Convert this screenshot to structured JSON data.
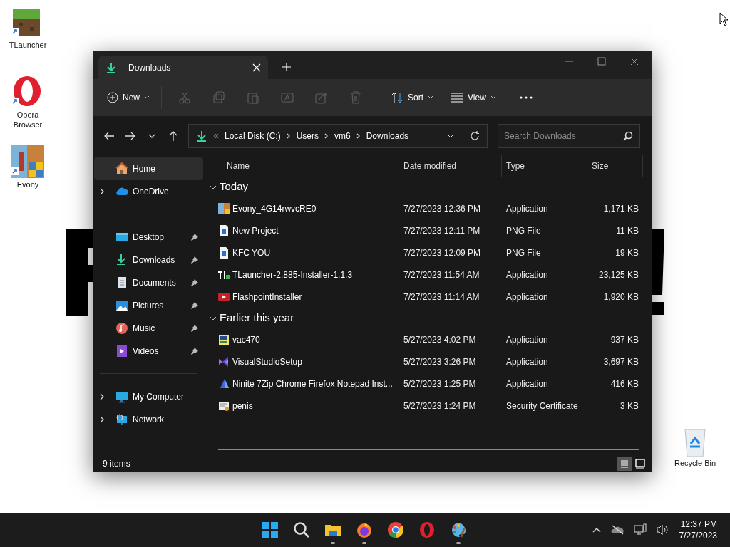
{
  "desktop_icons": [
    {
      "kind": "grass",
      "label": "TLauncher"
    },
    {
      "kind": "opera",
      "label": "Opera Browser"
    },
    {
      "kind": "evony",
      "label": "Evony"
    }
  ],
  "recycle_bin": {
    "label": "Recycle Bin"
  },
  "window": {
    "tab": {
      "title": "Downloads",
      "selected": true
    },
    "toolbar": {
      "new_label": "New",
      "tools": [
        {
          "kind": "cut",
          "disabled": true
        },
        {
          "kind": "copy",
          "disabled": true
        },
        {
          "kind": "paste",
          "disabled": true
        },
        {
          "kind": "rename",
          "disabled": true
        },
        {
          "kind": "share",
          "disabled": true
        },
        {
          "kind": "delete",
          "disabled": true
        }
      ],
      "sort_label": "Sort",
      "view_label": "View"
    },
    "address": {
      "segments": [
        "Local Disk (C:)",
        "Users",
        "vm6",
        "Downloads"
      ],
      "search_placeholder": "Search Downloads"
    },
    "sidebar": {
      "groups": [
        [
          {
            "kind": "home",
            "label": "Home",
            "selected": true,
            "expandable": false,
            "pinned": false
          },
          {
            "kind": "cloud",
            "label": "OneDrive",
            "selected": false,
            "expandable": true,
            "pinned": false
          }
        ],
        [
          {
            "kind": "desktop",
            "label": "Desktop",
            "selected": false,
            "expandable": false,
            "pinned": true
          },
          {
            "kind": "download",
            "label": "Downloads",
            "selected": false,
            "expandable": false,
            "pinned": true
          },
          {
            "kind": "document",
            "label": "Documents",
            "selected": false,
            "expandable": false,
            "pinned": true
          },
          {
            "kind": "pictures",
            "label": "Pictures",
            "selected": false,
            "expandable": false,
            "pinned": true
          },
          {
            "kind": "music",
            "label": "Music",
            "selected": false,
            "expandable": false,
            "pinned": true
          },
          {
            "kind": "videos",
            "label": "Videos",
            "selected": false,
            "expandable": false,
            "pinned": true
          }
        ],
        [
          {
            "kind": "computer",
            "label": "My Computer",
            "selected": false,
            "expandable": true,
            "pinned": false
          },
          {
            "kind": "network",
            "label": "Network",
            "selected": false,
            "expandable": true,
            "pinned": false
          }
        ]
      ]
    },
    "columns": [
      "Name",
      "Date modified",
      "Type",
      "Size"
    ],
    "groups": [
      {
        "title": "Today",
        "expanded": true,
        "files": [
          {
            "kind": "evony",
            "name": "Evony_4G14rwvcRE0",
            "date": "7/27/2023 12:36 PM",
            "type": "Application",
            "size": "1,171 KB"
          },
          {
            "kind": "png",
            "name": "New Project",
            "date": "7/27/2023 12:11 PM",
            "type": "PNG File",
            "size": "11 KB"
          },
          {
            "kind": "png",
            "name": "KFC YOU",
            "date": "7/27/2023 12:09 PM",
            "type": "PNG File",
            "size": "19 KB"
          },
          {
            "kind": "tlauncher",
            "name": "TLauncher-2.885-Installer-1.1.3",
            "date": "7/27/2023 11:54 AM",
            "type": "Application",
            "size": "23,125 KB"
          },
          {
            "kind": "flashpoint",
            "name": "FlashpointInstaller",
            "date": "7/27/2023 11:14 AM",
            "type": "Application",
            "size": "1,920 KB"
          }
        ]
      },
      {
        "title": "Earlier this year",
        "expanded": true,
        "files": [
          {
            "kind": "setup",
            "name": "vac470",
            "date": "5/27/2023 4:02 PM",
            "type": "Application",
            "size": "937 KB"
          },
          {
            "kind": "vs",
            "name": "VisualStudioSetup",
            "date": "5/27/2023 3:26 PM",
            "type": "Application",
            "size": "3,697 KB"
          },
          {
            "kind": "ninite",
            "name": "Ninite 7Zip Chrome Firefox Notepad Inst...",
            "date": "5/27/2023 1:25 PM",
            "type": "Application",
            "size": "416 KB"
          },
          {
            "kind": "cert",
            "name": "penis",
            "date": "5/27/2023 1:24 PM",
            "type": "Security Certificate",
            "size": "3 KB"
          }
        ]
      }
    ],
    "status": {
      "count": "9 items"
    },
    "view_buttons": [
      {
        "kind": "details",
        "selected": true
      },
      {
        "kind": "tiles",
        "selected": false
      }
    ]
  },
  "taskbar": {
    "apps": [
      {
        "kind": "start",
        "running": false
      },
      {
        "kind": "search",
        "running": false
      },
      {
        "kind": "explorer",
        "running": true
      },
      {
        "kind": "firefox",
        "running": true
      },
      {
        "kind": "chrome",
        "running": false
      },
      {
        "kind": "opera",
        "running": false
      },
      {
        "kind": "paint",
        "running": true
      }
    ],
    "time": "12:37 PM",
    "date": "7/27/2023"
  }
}
